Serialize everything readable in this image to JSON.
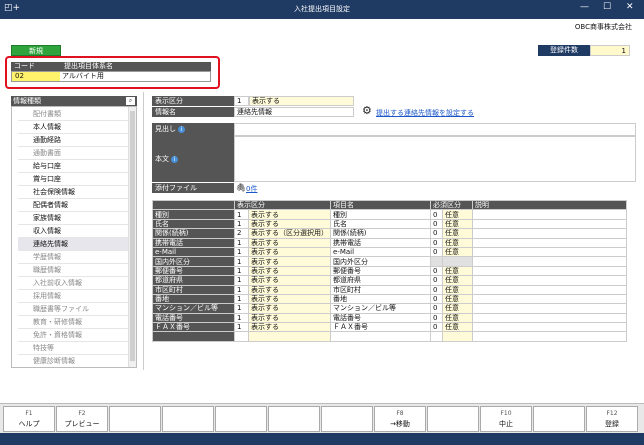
{
  "window": {
    "title": "入社提出項目設定",
    "app_icon": "◰+",
    "min": "—",
    "max": "☐",
    "close": "✕"
  },
  "company": "OBC商事株式会社",
  "new_button": "新規",
  "registration": {
    "label": "登録件数",
    "value": "1"
  },
  "code_header": {
    "code": "コード",
    "name": "提出項目体系名"
  },
  "code_row": {
    "code": "02",
    "name": "アルバイト用"
  },
  "sidebar": {
    "title": "情報種類",
    "items": [
      {
        "label": "配付書類",
        "dim": true
      },
      {
        "label": "本人情報",
        "dim": false
      },
      {
        "label": "通勤経路",
        "dim": false
      },
      {
        "label": "通勤書面",
        "dim": true
      },
      {
        "label": "給与口座",
        "dim": false
      },
      {
        "label": "賞与口座",
        "dim": false
      },
      {
        "label": "社会保険情報",
        "dim": false
      },
      {
        "label": "配偶者情報",
        "dim": false
      },
      {
        "label": "家族情報",
        "dim": false
      },
      {
        "label": "収入情報",
        "dim": false
      },
      {
        "label": "連絡先情報",
        "dim": false,
        "selected": true
      },
      {
        "label": "学歴情報",
        "dim": true
      },
      {
        "label": "職歴情報",
        "dim": true
      },
      {
        "label": "入社前収入情報",
        "dim": true
      },
      {
        "label": "採用情報",
        "dim": true
      },
      {
        "label": "職歴書等ファイル",
        "dim": true
      },
      {
        "label": "教育・研修情報",
        "dim": true
      },
      {
        "label": "免許・資格情報",
        "dim": true
      },
      {
        "label": "特技等",
        "dim": true
      },
      {
        "label": "健康診断情報",
        "dim": true
      }
    ]
  },
  "form": {
    "display_label": "表示区分",
    "display_num": "1",
    "display_text": "表示する",
    "infoname_label": "情報名",
    "infoname_value": "連絡先情報",
    "link_text": "提出する連絡先情報を設定する",
    "heading_label": "見出し",
    "body_label": "本文",
    "attach_label": "添付ファイル",
    "attach_value": "0件"
  },
  "table": {
    "headers": [
      "表示区分",
      "項目名",
      "必須区分",
      "説明"
    ],
    "rows": [
      {
        "name": "種別",
        "num": "1",
        "disp": "表示する",
        "item": "種別",
        "req_num": "0",
        "req": "任意"
      },
      {
        "name": "氏名",
        "num": "1",
        "disp": "表示する",
        "item": "氏名",
        "req_num": "0",
        "req": "任意"
      },
      {
        "name": "関係(続柄)",
        "num": "2",
        "disp": "表示する（区分選択用）",
        "item": "関係(続柄)",
        "req_num": "0",
        "req": "任意"
      },
      {
        "name": "携帯電話",
        "num": "1",
        "disp": "表示する",
        "item": "携帯電話",
        "req_num": "0",
        "req": "任意"
      },
      {
        "name": "e-Mail",
        "num": "1",
        "disp": "表示する",
        "item": "e-Mail",
        "req_num": "0",
        "req": "任意"
      },
      {
        "name": "国内外区分",
        "num": "1",
        "disp": "表示する",
        "item": "国内外区分",
        "req_num": "",
        "req": ""
      },
      {
        "name": "郵便番号",
        "num": "1",
        "disp": "表示する",
        "item": "郵便番号",
        "req_num": "0",
        "req": "任意"
      },
      {
        "name": "都道府県",
        "num": "1",
        "disp": "表示する",
        "item": "都道府県",
        "req_num": "0",
        "req": "任意"
      },
      {
        "name": "市区町村",
        "num": "1",
        "disp": "表示する",
        "item": "市区町村",
        "req_num": "0",
        "req": "任意"
      },
      {
        "name": "番地",
        "num": "1",
        "disp": "表示する",
        "item": "番地",
        "req_num": "0",
        "req": "任意"
      },
      {
        "name": "マンション／ビル等",
        "num": "1",
        "disp": "表示する",
        "item": "マンション／ビル等",
        "req_num": "0",
        "req": "任意"
      },
      {
        "name": "電話番号",
        "num": "1",
        "disp": "表示する",
        "item": "電話番号",
        "req_num": "0",
        "req": "任意"
      },
      {
        "name": "ＦＡＸ番号",
        "num": "1",
        "disp": "表示する",
        "item": "ＦＡＸ番号",
        "req_num": "0",
        "req": "任意"
      }
    ]
  },
  "fkeys": [
    {
      "key": "F1",
      "label": "ヘルプ"
    },
    {
      "key": "F2",
      "label": "プレビュー"
    },
    {
      "key": "",
      "label": ""
    },
    {
      "key": "",
      "label": ""
    },
    {
      "key": "",
      "label": ""
    },
    {
      "key": "",
      "label": ""
    },
    {
      "key": "",
      "label": ""
    },
    {
      "key": "F8",
      "label": "→移動"
    },
    {
      "key": "",
      "label": ""
    },
    {
      "key": "F10",
      "label": "中止"
    },
    {
      "key": "",
      "label": ""
    },
    {
      "key": "F12",
      "label": "登録"
    }
  ]
}
